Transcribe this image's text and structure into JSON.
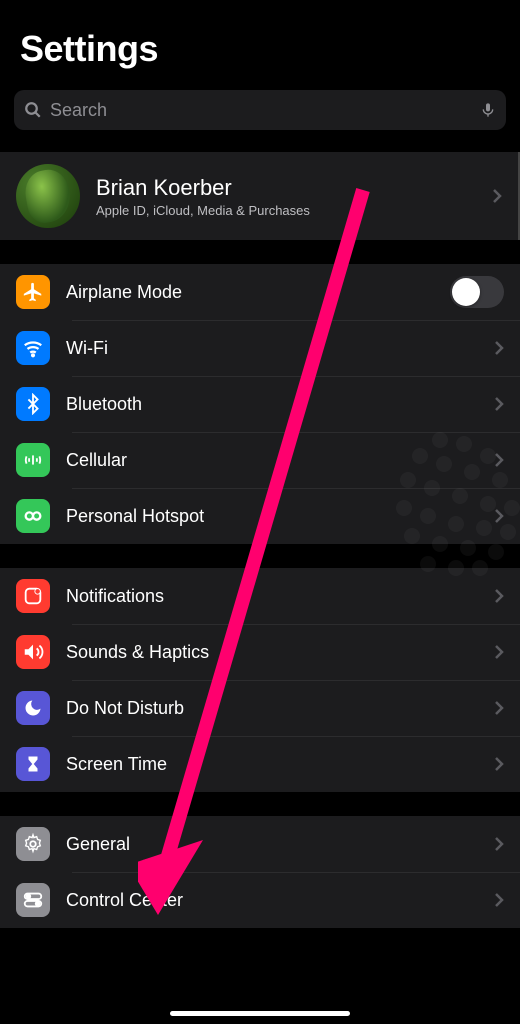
{
  "header": {
    "title": "Settings"
  },
  "search": {
    "placeholder": "Search"
  },
  "account": {
    "name": "Brian Koerber",
    "subtitle": "Apple ID, iCloud, Media & Purchases"
  },
  "group1": {
    "airplane": {
      "label": "Airplane Mode"
    },
    "wifi": {
      "label": "Wi-Fi"
    },
    "bluetooth": {
      "label": "Bluetooth"
    },
    "cellular": {
      "label": "Cellular"
    },
    "hotspot": {
      "label": "Personal Hotspot"
    }
  },
  "group2": {
    "notifications": {
      "label": "Notifications"
    },
    "sounds": {
      "label": "Sounds & Haptics"
    },
    "dnd": {
      "label": "Do Not Disturb"
    },
    "screentime": {
      "label": "Screen Time"
    }
  },
  "group3": {
    "general": {
      "label": "General"
    },
    "controlcenter": {
      "label": "Control Center"
    }
  },
  "colors": {
    "arrow": "#ff006e"
  }
}
